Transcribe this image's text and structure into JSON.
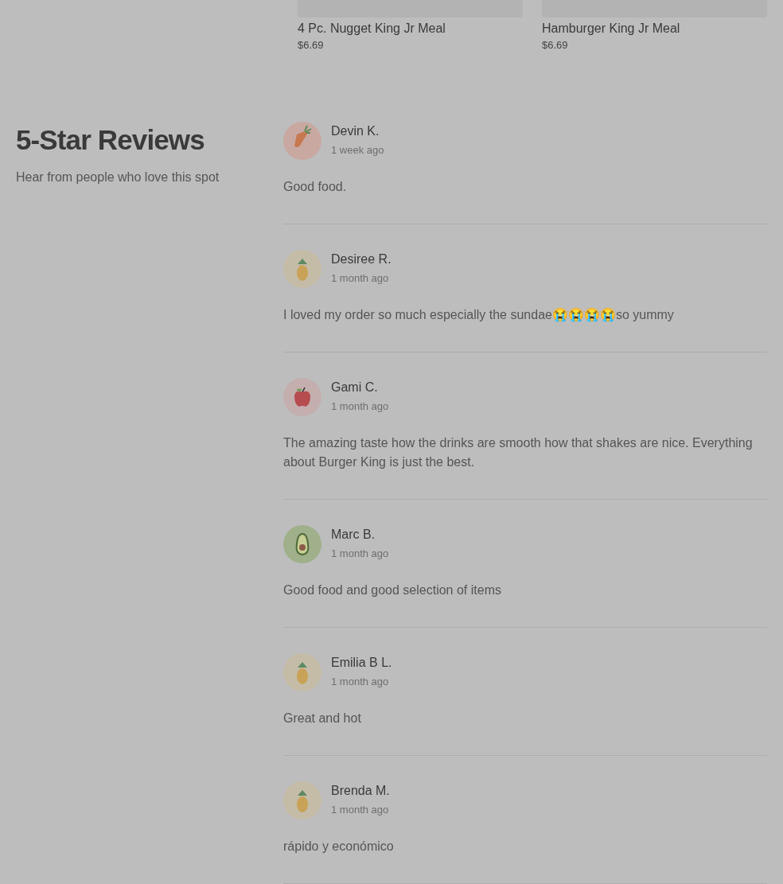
{
  "menu_items": [
    {
      "name": "4 Pc. Nugget King Jr Meal",
      "price": "$6.69"
    },
    {
      "name": "Hamburger King Jr Meal",
      "price": "$6.69"
    }
  ],
  "reviews_section": {
    "title": "5-Star Reviews",
    "subtitle": "Hear from people who love this spot"
  },
  "reviews": [
    {
      "kind": "carrot",
      "name": "Devin K.",
      "time": "1 week ago",
      "text": "Good food."
    },
    {
      "kind": "pineapple",
      "name": "Desiree R.",
      "time": "1 month ago",
      "text": "I loved my order so much especially the sundae😭😭😭😭so yummy"
    },
    {
      "kind": "apple",
      "name": "Gami C.",
      "time": "1 month ago",
      "text": "The amazing taste how the drinks are smooth how that shakes are nice. Everything about Burger King is just the best."
    },
    {
      "kind": "avocado",
      "name": "Marc B.",
      "time": "1 month ago",
      "text": "Good food and good selection of items"
    },
    {
      "kind": "pineapple",
      "name": "Emilia B L.",
      "time": "1 month ago",
      "text": "Great and hot"
    },
    {
      "kind": "pineapple",
      "name": "Brenda M.",
      "time": "1 month ago",
      "text": "rápido y económico"
    }
  ]
}
